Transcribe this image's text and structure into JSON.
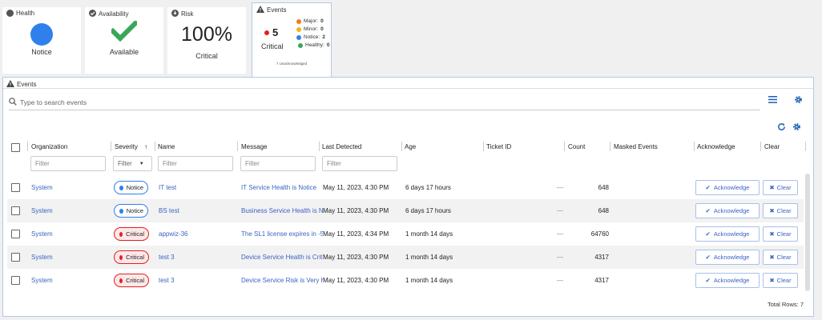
{
  "cards": {
    "health": {
      "label": "Health",
      "status": "Notice"
    },
    "availability": {
      "label": "Availability",
      "status": "Available"
    },
    "risk": {
      "label": "Risk",
      "value": "100%",
      "status": "Critical"
    },
    "events": {
      "label": "Events",
      "count": "5",
      "severity": "Critical",
      "breakdown": [
        {
          "label": "Major:",
          "count": "0",
          "color": "#f07c1a"
        },
        {
          "label": "Minor:",
          "count": "0",
          "color": "#f2b31c"
        },
        {
          "label": "Notice:",
          "count": "2",
          "color": "#2f80ed"
        },
        {
          "label": "Healthy:",
          "count": "0",
          "color": "#3aa757"
        }
      ],
      "unacknowledged": "7 Unacknowledged"
    }
  },
  "panel": {
    "title": "Events",
    "search_placeholder": "Type to search events",
    "columns": {
      "organization": "Organization",
      "severity": "Severity",
      "name": "Name",
      "message": "Message",
      "last_detected": "Last Detected",
      "age": "Age",
      "ticket_id": "Ticket ID",
      "count": "Count",
      "masked_events": "Masked Events",
      "acknowledge": "Acknowledge",
      "clear": "Clear"
    },
    "filter_placeholder": "Filter",
    "rows": [
      {
        "organization": "System",
        "severity": "Notice",
        "name": "IT test",
        "message": "IT Service Health is Notice",
        "last_detected": "May 11, 2023, 4:30 PM",
        "age": "6 days 17 hours",
        "ticket_id": "—",
        "count": "648"
      },
      {
        "organization": "System",
        "severity": "Notice",
        "name": "BS test",
        "message": "Business Service Health is N",
        "last_detected": "May 11, 2023, 4:30 PM",
        "age": "6 days 17 hours",
        "ticket_id": "—",
        "count": "648"
      },
      {
        "organization": "System",
        "severity": "Critical",
        "name": "appwiz-36",
        "message": "The SL1 license expires in -5",
        "last_detected": "May 11, 2023, 4:34 PM",
        "age": "1 month 14 days",
        "ticket_id": "—",
        "count": "64760"
      },
      {
        "organization": "System",
        "severity": "Critical",
        "name": "test 3",
        "message": "Device Service Health is Crit",
        "last_detected": "May 11, 2023, 4:30 PM",
        "age": "1 month 14 days",
        "ticket_id": "—",
        "count": "4317"
      },
      {
        "organization": "System",
        "severity": "Critical",
        "name": "test 3",
        "message": "Device Service Risk is Very H",
        "last_detected": "May 11, 2023, 4:30 PM",
        "age": "1 month 14 days",
        "ticket_id": "—",
        "count": "4317"
      }
    ],
    "acknowledge_label": "Acknowledge",
    "clear_label": "Clear",
    "total_rows": "Total Rows: 7"
  },
  "icons": {
    "notice_color": "#2f80ed",
    "critical_color": "#e02020",
    "available_color": "#3aa757"
  }
}
